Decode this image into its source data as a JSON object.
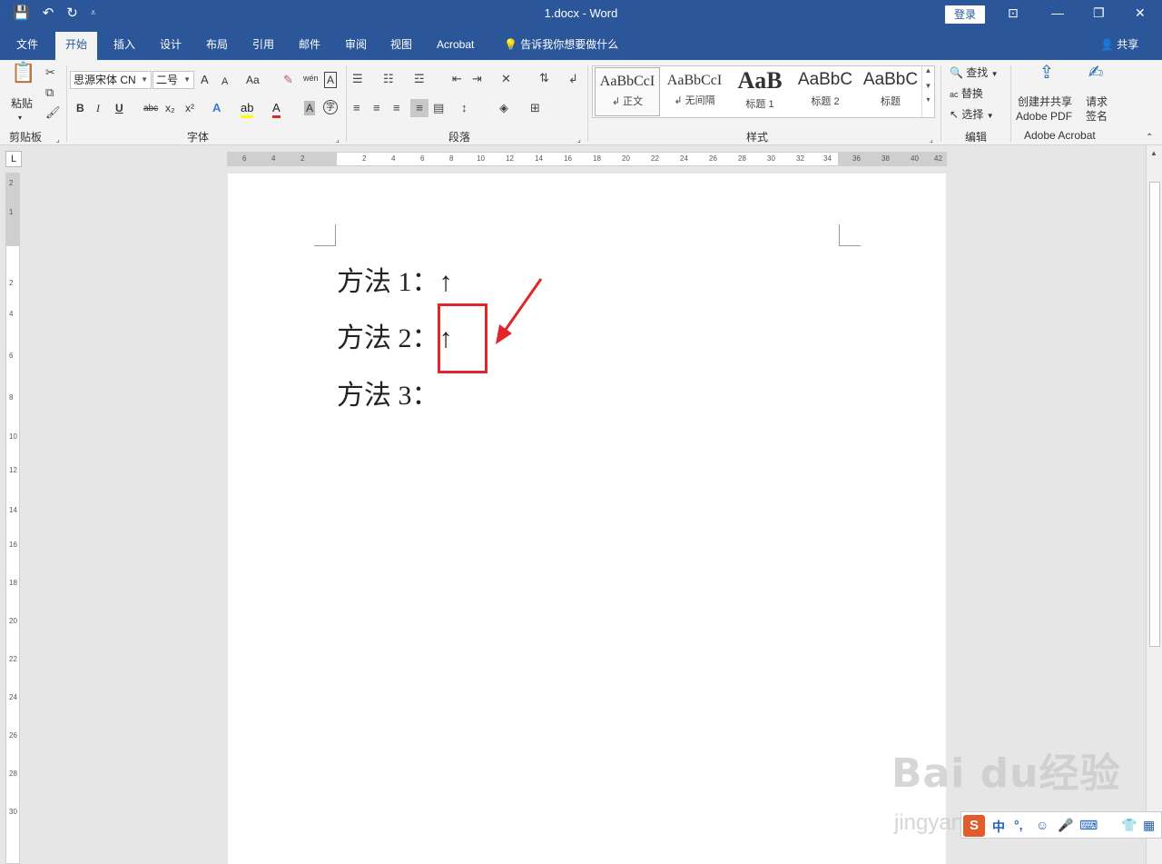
{
  "titlebar": {
    "doc_title": "1.docx  -  Word",
    "login": "登录",
    "icons": [
      "save-icon",
      "undo-icon",
      "redo-icon",
      "customize-icon",
      "ribbon-display-icon",
      "minimize-icon",
      "restore-icon",
      "close-icon"
    ]
  },
  "tabs": [
    {
      "label": "文件"
    },
    {
      "label": "开始",
      "active": true
    },
    {
      "label": "插入"
    },
    {
      "label": "设计"
    },
    {
      "label": "布局"
    },
    {
      "label": "引用"
    },
    {
      "label": "邮件"
    },
    {
      "label": "审阅"
    },
    {
      "label": "视图"
    },
    {
      "label": "Acrobat"
    },
    {
      "label": "告诉我你想要做什么"
    }
  ],
  "share": "共享",
  "ribbon": {
    "clipboard": {
      "paste": "粘贴",
      "label": "剪贴板"
    },
    "font": {
      "label": "字体",
      "font_name": "思源宋体 CN",
      "font_size": "二号",
      "bold": "B",
      "italic": "I",
      "underline": "U",
      "strike": "abc",
      "sub": "x₂",
      "sup": "x²",
      "change_case": "Aa",
      "phonetic": "wén",
      "grow": "A",
      "shrink": "A",
      "border": "A",
      "shade": "A",
      "enclose": "字"
    },
    "paragraph": {
      "label": "段落"
    },
    "styles": {
      "label": "样式",
      "items": [
        {
          "sample": "AaBbCcI",
          "name": "↲ 正文"
        },
        {
          "sample": "AaBbCcI",
          "name": "↲ 无间隔"
        },
        {
          "sample": "AaB",
          "name": "标题 1"
        },
        {
          "sample": "AaBbC",
          "name": "标题 2"
        },
        {
          "sample": "AaBbC",
          "name": "标题"
        }
      ]
    },
    "editing": {
      "label": "编辑",
      "find": "查找",
      "replace": "替换",
      "select": "选择"
    },
    "acrobat": {
      "label": "Adobe Acrobat",
      "create_share": "创建并共享",
      "adobe_pdf": "Adobe PDF",
      "request": "请求",
      "sign": "签名"
    }
  },
  "ruler": {
    "corner": "L",
    "h_ticks": [
      "6",
      "4",
      "2",
      "2",
      "4",
      "6",
      "8",
      "10",
      "12",
      "14",
      "16",
      "18",
      "20",
      "22",
      "24",
      "26",
      "28",
      "30",
      "32",
      "34",
      "36",
      "38",
      "40",
      "42"
    ],
    "v_ticks": [
      "2",
      "1",
      "2",
      "4",
      "6",
      "8",
      "10",
      "12",
      "14",
      "16",
      "18",
      "20",
      "22",
      "24",
      "26",
      "28",
      "30"
    ]
  },
  "document": {
    "lines": [
      "方法 1：↑",
      "方法 2：↑",
      "方法 3："
    ]
  },
  "annotation": {
    "color": "#e0262b"
  },
  "watermark": {
    "brand": "Bai du经验",
    "url": "jingyan.baidu.com"
  },
  "ime": {
    "logo": "S",
    "items": [
      "中",
      "°,",
      "☺",
      "🎤",
      "⌨",
      "👕",
      "▦"
    ]
  },
  "colors": {
    "accent": "#2b579a",
    "ribbon_bg": "#f3f3f3",
    "annotation": "#e0262b"
  }
}
